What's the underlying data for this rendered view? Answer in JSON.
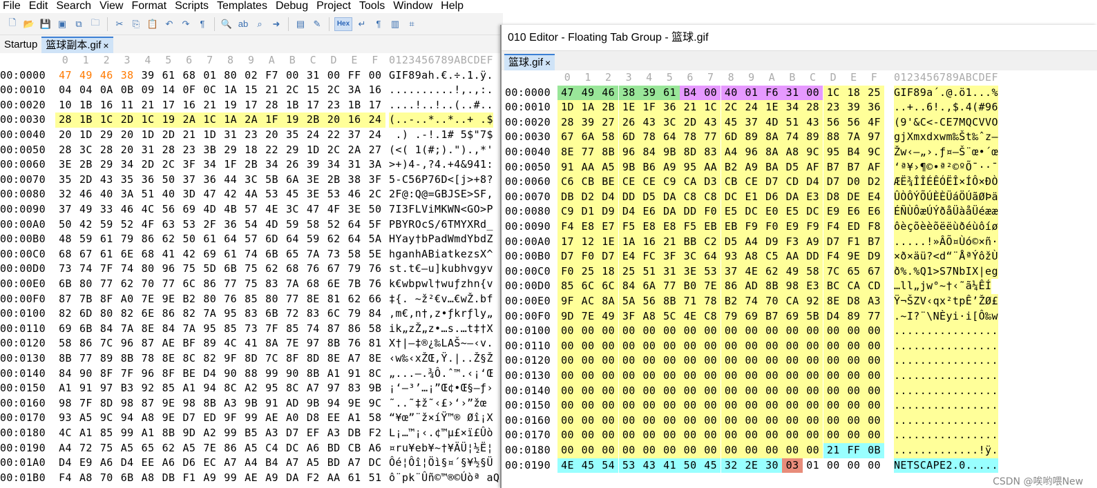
{
  "menu": [
    "File",
    "Edit",
    "Search",
    "View",
    "Format",
    "Scripts",
    "Templates",
    "Debug",
    "Project",
    "Tools",
    "Window",
    "Help"
  ],
  "toolbar": {
    "hex_label": "Hex",
    "icons": [
      "new-file-icon",
      "open-folder-icon",
      "save-icon",
      "save-as-icon",
      "save-all-icon",
      "open-project-icon",
      "cut-icon",
      "copy-icon",
      "paste-icon",
      "undo-icon",
      "redo-icon",
      "paragraph-icon",
      "find-icon",
      "replace-icon",
      "find-in-files-icon",
      "goto-icon",
      "template-icon",
      "script-icon",
      "hex-mode-button",
      "line-break-icon",
      "columns-icon",
      "calculator-icon"
    ]
  },
  "editor1": {
    "tabs": [
      {
        "label": "Startup"
      },
      {
        "label": "篮球副本.gif"
      }
    ],
    "col_header": [
      "0",
      "1",
      "2",
      "3",
      "4",
      "5",
      "6",
      "7",
      "8",
      "9",
      "A",
      "B",
      "C",
      "D",
      "E",
      "F"
    ],
    "ascii_header": "0123456789ABCDEF",
    "rows": [
      {
        "off": "00:0000",
        "hex": "47 49 46 38 39 61 68 01 80 02 F7 00 31 00 FF 00",
        "asc": "GIF89ah.€.÷.1.ÿ."
      },
      {
        "off": "00:0010",
        "hex": "04 04 0A 0B 09 14 0F 0C 1A 15 21 2C 15 2C 3A 16",
        "asc": "..........!,.,:."
      },
      {
        "off": "00:0020",
        "hex": "10 1B 16 11 21 17 16 21 19 17 28 1B 17 23 1B 17",
        "asc": "....!..!..(..#.."
      },
      {
        "off": "00:0030",
        "hex": "28 1B 1C 2D 1C 19 2A 1C 1A 2A 1F 19 2B 20 16 24",
        "asc": "(..-..*..*..+ .$"
      },
      {
        "off": "00:0040",
        "hex": "20 1D 29 20 1D 2D 21 1D 31 23 20 35 24 22 37 24",
        "asc": " .) .-!.1# 5$\"7$"
      },
      {
        "off": "00:0050",
        "hex": "28 3C 28 20 31 28 23 3B 29 18 22 29 1D 2C 2A 27",
        "asc": "(<( 1(#;).\").,*'"
      },
      {
        "off": "00:0060",
        "hex": "3E 2B 29 34 2D 2C 3F 34 1F 2B 34 26 39 34 31 3A",
        "asc": ">+)4-,?4.+4&941:"
      },
      {
        "off": "00:0070",
        "hex": "35 2D 43 35 36 50 37 36 44 3C 5B 6A 3E 2B 38 3F",
        "asc": "5-C56P76D<[j>+8?"
      },
      {
        "off": "00:0080",
        "hex": "32 46 40 3A 51 40 3D 47 42 4A 53 45 3E 53 46 2C",
        "asc": "2F@:Q@=GBJSE>SF,"
      },
      {
        "off": "00:0090",
        "hex": "37 49 33 46 4C 56 69 4D 4B 57 4E 3C 47 4F 3E 50",
        "asc": "7I3FLViMKWN<GO>P"
      },
      {
        "off": "00:00A0",
        "hex": "50 42 59 52 4F 63 53 2F 36 54 4D 59 58 52 64 5F",
        "asc": "PBYROcS/6TMYXRd_"
      },
      {
        "off": "00:00B0",
        "hex": "48 59 61 79 86 62 50 61 64 57 6D 64 59 62 64 5A",
        "asc": "HYay†bPadWmdYbdZ"
      },
      {
        "off": "00:00C0",
        "hex": "68 67 61 6E 68 41 42 69 61 74 6B 65 7A 73 58 5E",
        "asc": "hganhABiatkezsX^"
      },
      {
        "off": "00:00D0",
        "hex": "73 74 7F 74 80 96 75 5D 6B 75 62 68 76 67 79 76",
        "asc": "st.t€–u]kubhvgyv"
      },
      {
        "off": "00:00E0",
        "hex": "6B 80 77 62 70 77 6C 86 77 75 83 7A 68 6E 7B 76",
        "asc": "k€wbpwl†wuƒzhn{v"
      },
      {
        "off": "00:00F0",
        "hex": "87 7B 8F A0 7E 9E B2 80 76 85 80 77 8E 81 62 66",
        "asc": "‡{. ~ž²€v…€wŽ.bf"
      },
      {
        "off": "00:0100",
        "hex": "82 6D 80 82 6E 86 82 7A 95 83 6B 72 83 6C 79 84",
        "asc": "‚m€‚n†‚z•ƒkrƒly„"
      },
      {
        "off": "00:0110",
        "hex": "69 6B 84 7A 8E 84 7A 95 85 73 7F 85 74 87 86 58",
        "asc": "ik„zŽ„z•…s.…t‡†X"
      },
      {
        "off": "00:0120",
        "hex": "58 86 7C 96 87 AE BF 89 4C 41 8A 7E 97 8B 76 81",
        "asc": "X†|–‡®¿‰LAŠ~—‹v."
      },
      {
        "off": "00:0130",
        "hex": "8B 77 89 8B 78 8E 8C 82 9F 8D 7C 8F 8D 8E A7 8E",
        "asc": "‹w‰‹xŽŒ‚Ÿ.|..Ž§Ž"
      },
      {
        "off": "00:0140",
        "hex": "84 90 8F 7F 96 8F BE D4 90 88 99 90 8B A1 91 8C",
        "asc": "„...–.¾Ô.ˆ™.‹¡‘Œ"
      },
      {
        "off": "00:0150",
        "hex": "A1 91 97 B3 92 85 A1 94 8C A2 95 8C A7 97 83 9B",
        "asc": "¡‘—³’…¡”Œ¢•Œ§—ƒ›"
      },
      {
        "off": "00:0160",
        "hex": "98 7F 8D 98 87 9E 98 8B A3 9B 91 AD 9B 94 9E 9C",
        "asc": "˜..˜‡ž˜‹£›‘­›”žœ"
      },
      {
        "off": "00:0170",
        "hex": "93 A5 9C 94 A8 9E D7 ED 9F 99 AE A0 D8 EE A1 58",
        "asc": "“¥œ”¨ž×íŸ™® Øî¡X"
      },
      {
        "off": "00:0180",
        "hex": "4C A1 85 99 A1 8B 9D A2 99 B5 A3 D7 EF A3 DB F2",
        "asc": "L¡…™¡‹.¢™µ£×ï£Ûò"
      },
      {
        "off": "00:0190",
        "hex": "A4 72 75 A5 65 62 A5 7E 86 A5 C4 DC A6 BD CB A6",
        "asc": "¤ru¥eb¥~†¥ÄÜ¦½Ë¦"
      },
      {
        "off": "00:01A0",
        "hex": "D4 E9 A6 D4 EE A6 D6 EC A7 A4 B4 A7 A5 BD A7 DC",
        "asc": "Ôé¦Ôî¦Öì§¤´§¥½§Ü"
      },
      {
        "off": "00:01B0",
        "hex": "F4 A8 70 6B A8 DB F1 A9 99 AE A9 DA F2 AA 61 51",
        "asc": "ô¨pk¨Ûñ©™®©Úòª aQ"
      }
    ]
  },
  "editor2": {
    "title": "010 Editor - Floating Tab Group - 篮球.gif",
    "tab": "篮球.gif",
    "col_header": [
      "0",
      "1",
      "2",
      "3",
      "4",
      "5",
      "6",
      "7",
      "8",
      "9",
      "A",
      "B",
      "C",
      "D",
      "E",
      "F"
    ],
    "ascii_header": "0123456789ABCDEF",
    "rows": [
      {
        "off": "00:0000",
        "hex": "47 49 46 38 39 61 B4 00 40 01 F6 31 00 1C 18 25",
        "asc": "GIF89a´.@.ö1...%"
      },
      {
        "off": "00:0010",
        "hex": "1D 1A 2B 1E 1F 36 21 1C 2C 24 1E 34 28 23 39 36",
        "asc": "..+..6!.,$.4(#96"
      },
      {
        "off": "00:0020",
        "hex": "28 39 27 26 43 3C 2D 43 45 37 4D 51 43 56 56 4F",
        "asc": "(9'&C<-CE7MQCVVO"
      },
      {
        "off": "00:0030",
        "hex": "67 6A 58 6D 78 64 78 77 6D 89 8A 74 89 88 7A 97",
        "asc": "gjXmxdxwm‰Št‰ˆz—"
      },
      {
        "off": "00:0040",
        "hex": "8E 77 8B 96 84 9B 8D 83 A4 96 8A A8 9C 95 B4 9C",
        "asc": "Žw‹–„›.ƒ¤–Š¨œ•´œ"
      },
      {
        "off": "00:0050",
        "hex": "91 AA A5 9B B6 A9 95 AA B2 A9 BA D5 AF B7 B7 AF",
        "asc": "‘ª¥›¶©•ª²©ºÕ¯··¯"
      },
      {
        "off": "00:0060",
        "hex": "C6 CB BE CE CE C9 CA D3 CB CE D7 CD D4 D7 D0 D2",
        "asc": "ÆË¾ÎÎÉÊÓËÎ×ÍÔ×ÐÒ"
      },
      {
        "off": "00:0070",
        "hex": "DB D2 D4 DD D5 DA C8 C8 DC E1 D6 DA E3 D8 DE E4",
        "asc": "ÛÒÔÝÕÚÈÈÜáÖÚãØÞä"
      },
      {
        "off": "00:0080",
        "hex": "C9 D1 D9 D4 E6 DA DD F0 E5 DC E0 E5 DC E9 E6 E6",
        "asc": "ÉÑÙÔæÚÝðåÜàåÜéææ"
      },
      {
        "off": "00:0090",
        "hex": "F4 E8 E7 F5 E8 E8 F5 EB EB F9 F0 E9 F9 F4 ED F8",
        "asc": "ôèçõèèõëëùðéùôíø"
      },
      {
        "off": "00:00A0",
        "hex": "17 12 1E 1A 16 21 BB C2 D5 A4 D9 F3 A9 D7 F1 B7",
        "asc": ".....!»ÂÕ¤Ùó©×ñ·"
      },
      {
        "off": "00:00B0",
        "hex": "D7 F0 D7 E4 FC 3F 3C 64 93 A8 C5 AA DD F4 9E D9",
        "asc": "×ð×äü?<d“¨ÅªÝôžÙ"
      },
      {
        "off": "00:00C0",
        "hex": "F0 25 18 25 51 31 3E 53 37 4E 62 49 58 7C 65 67",
        "asc": "ð%.%Q1>S7NbIX|eg"
      },
      {
        "off": "00:00D0",
        "hex": "85 6C 6C 84 6A 77 B0 7E 86 AD 8B 98 E3 BC CA CD",
        "asc": "…ll„jw°~†­‹˜ã¼ÊÍ"
      },
      {
        "off": "00:00E0",
        "hex": "9F AC 8A 5A 56 8B 71 78 B2 74 70 CA 92 8E D8 A3",
        "asc": "Ÿ¬ŠZV‹qx²tpÊ’ŽØ£"
      },
      {
        "off": "00:00F0",
        "hex": "9D 7E 49 3F A8 5C 4E C8 79 69 B7 69 5B D4 89 77",
        "asc": ".~I?¨\\NÈyi·i[Ô‰w"
      },
      {
        "off": "00:0100",
        "hex": "00 00 00 00 00 00 00 00 00 00 00 00 00 00 00 00",
        "asc": "................"
      },
      {
        "off": "00:0110",
        "hex": "00 00 00 00 00 00 00 00 00 00 00 00 00 00 00 00",
        "asc": "................"
      },
      {
        "off": "00:0120",
        "hex": "00 00 00 00 00 00 00 00 00 00 00 00 00 00 00 00",
        "asc": "................"
      },
      {
        "off": "00:0130",
        "hex": "00 00 00 00 00 00 00 00 00 00 00 00 00 00 00 00",
        "asc": "................"
      },
      {
        "off": "00:0140",
        "hex": "00 00 00 00 00 00 00 00 00 00 00 00 00 00 00 00",
        "asc": "................"
      },
      {
        "off": "00:0150",
        "hex": "00 00 00 00 00 00 00 00 00 00 00 00 00 00 00 00",
        "asc": "................"
      },
      {
        "off": "00:0160",
        "hex": "00 00 00 00 00 00 00 00 00 00 00 00 00 00 00 00",
        "asc": "................"
      },
      {
        "off": "00:0170",
        "hex": "00 00 00 00 00 00 00 00 00 00 00 00 00 00 00 00",
        "asc": "................"
      },
      {
        "off": "00:0180",
        "hex": "00 00 00 00 00 00 00 00 00 00 00 00 00 21 FF 0B",
        "asc": ".............!ÿ."
      },
      {
        "off": "00:0190",
        "hex": "4E 45 54 53 43 41 50 45 32 2E 30 03 01 00 00 00",
        "asc": "NETSCAPE2.0....."
      }
    ]
  },
  "colors": {
    "orange": "#ff7a00",
    "yellow": "#ffff99",
    "green": "#99e699",
    "magenta": "#e699ff",
    "cyan": "#99ffff",
    "salmon": "#e88c7a",
    "grey": "#d9d9d9",
    "offset": "#000000"
  },
  "watermark": "CSDN @唉哟喂New"
}
